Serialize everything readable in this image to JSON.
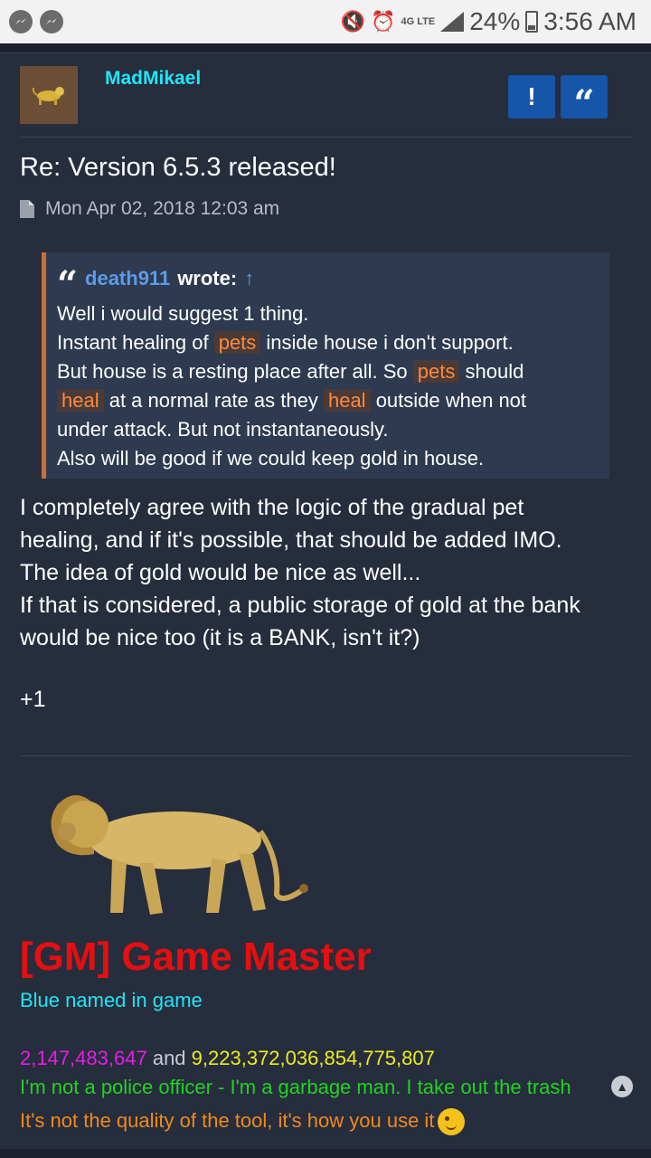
{
  "status_bar": {
    "battery": "24%",
    "time": "3:56 AM",
    "network": "4G LTE"
  },
  "post": {
    "author": "MadMikael",
    "title": "Re: Version 6.5.3 released!",
    "timestamp": "Mon Apr 02, 2018 12:03 am",
    "report_label": "!",
    "quote_label": "“",
    "quote": {
      "mark": "“",
      "user": "death911",
      "wrote": "wrote:",
      "arrow": "↑",
      "line1": "Well i would suggest 1 thing.",
      "line2_a": "Instant healing of",
      "line2_hl": "pets",
      "line2_b": "inside house i don't support.",
      "line3_a": "But house is a resting place after all. So",
      "line3_hl": "pets",
      "line3_b": "should",
      "line4_hl1": "heal",
      "line4_a": "at a normal rate as they",
      "line4_hl2": "heal",
      "line4_b": "outside when not",
      "line5": "under attack. But not instantaneously.",
      "line6": "Also will be good if we could keep gold in house."
    },
    "body": [
      "I completely agree with the logic of the gradual pet",
      "healing, and if it's possible, that should be added IMO.",
      "The idea of gold would be nice as well...",
      "If that is considered, a public storage of gold at the bank",
      "would be nice too (it is a BANK, isn't it?)"
    ],
    "plus_one": "+1"
  },
  "signature": {
    "rank": "[GM] Game Master",
    "subtitle": "Blue named in game",
    "num1": "2,147,483,647",
    "and": "and",
    "num2": "9,223,372,036,854,775,807",
    "line2": "I'm not a police officer - I'm a garbage man. I take out the trash",
    "line3": "It's not the quality of the tool, it's how you use it"
  },
  "colors": {
    "accent_cyan": "#1ee6f5",
    "button_blue": "#1556a8",
    "rank_red": "#e60f0f",
    "highlight_orange": "#ff8a3c"
  }
}
